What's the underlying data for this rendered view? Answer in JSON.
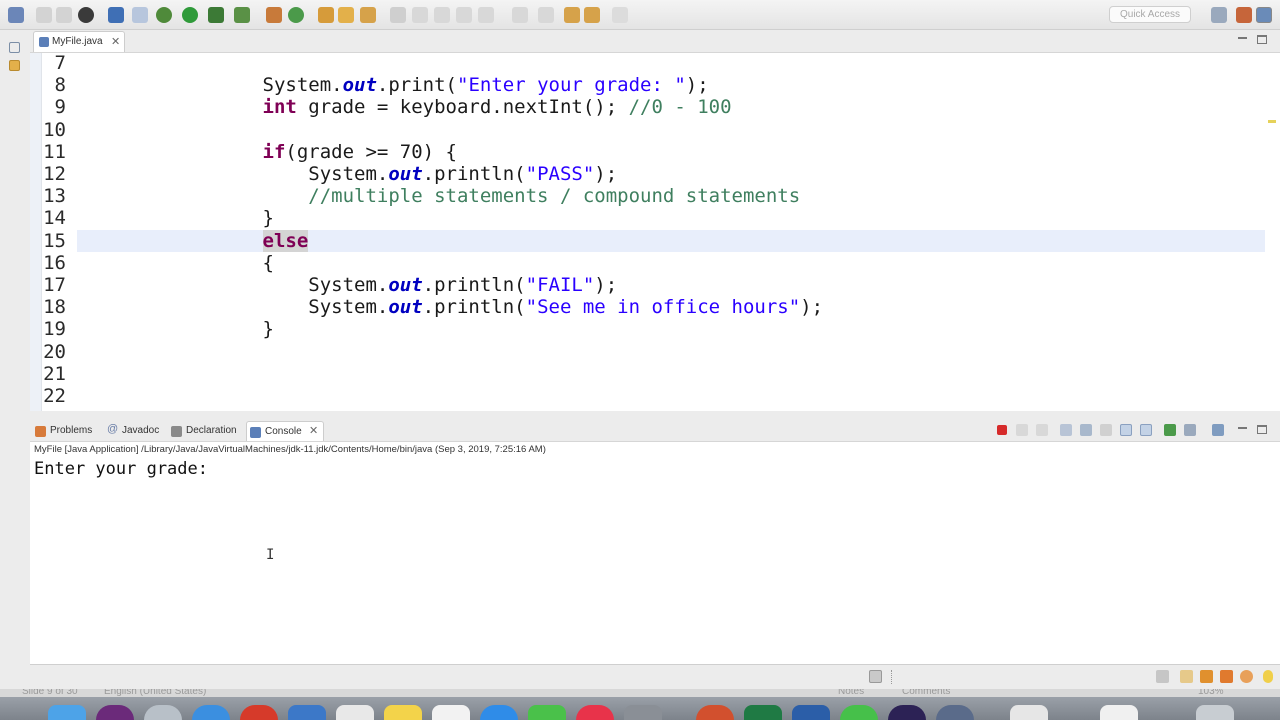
{
  "toolbar": {
    "quick_access_placeholder": "Quick Access"
  },
  "editor": {
    "tab_label": "MyFile.java",
    "lines": [
      {
        "num": "7",
        "tokens": []
      },
      {
        "num": "8",
        "tokens": [
          [
            "p",
            "        System."
          ],
          [
            "fld",
            "out"
          ],
          [
            "p",
            ".print("
          ],
          [
            "str",
            "\"Enter your grade: \""
          ],
          [
            "p",
            ");"
          ]
        ]
      },
      {
        "num": "9",
        "tokens": [
          [
            "p",
            "        "
          ],
          [
            "kw",
            "int"
          ],
          [
            "p",
            " grade = keyboard.nextInt(); "
          ],
          [
            "cmt",
            "//0 - 100"
          ]
        ]
      },
      {
        "num": "10",
        "tokens": []
      },
      {
        "num": "11",
        "tokens": [
          [
            "p",
            "        "
          ],
          [
            "kw",
            "if"
          ],
          [
            "p",
            "(grade >= 70) {"
          ]
        ]
      },
      {
        "num": "12",
        "tokens": [
          [
            "p",
            "            System."
          ],
          [
            "fld",
            "out"
          ],
          [
            "p",
            ".println("
          ],
          [
            "str",
            "\"PASS\""
          ],
          [
            "p",
            ");"
          ]
        ]
      },
      {
        "num": "13",
        "tokens": [
          [
            "p",
            "            "
          ],
          [
            "cmt",
            "//multiple statements / compound statements"
          ]
        ]
      },
      {
        "num": "14",
        "tokens": [
          [
            "p",
            "        }"
          ]
        ]
      },
      {
        "num": "15",
        "highlight": true,
        "tokens": [
          [
            "p",
            "        "
          ],
          [
            "kwsel",
            "else"
          ]
        ]
      },
      {
        "num": "16",
        "tokens": [
          [
            "p",
            "        {"
          ]
        ]
      },
      {
        "num": "17",
        "tokens": [
          [
            "p",
            "            System."
          ],
          [
            "fld",
            "out"
          ],
          [
            "p",
            ".println("
          ],
          [
            "str",
            "\"FAIL\""
          ],
          [
            "p",
            ");"
          ]
        ]
      },
      {
        "num": "18",
        "tokens": [
          [
            "p",
            "            System."
          ],
          [
            "fld",
            "out"
          ],
          [
            "p",
            ".println("
          ],
          [
            "str",
            "\"See me in office hours\""
          ],
          [
            "p",
            ");"
          ]
        ]
      },
      {
        "num": "19",
        "tokens": [
          [
            "p",
            "        }"
          ]
        ]
      },
      {
        "num": "20",
        "tokens": []
      },
      {
        "num": "21",
        "tokens": []
      },
      {
        "num": "22",
        "tokens": []
      }
    ]
  },
  "console": {
    "tabs": [
      "Problems",
      "Javadoc",
      "Declaration",
      "Console"
    ],
    "active_tab": "Console",
    "process_info": "MyFile [Java Application] /Library/Java/JavaVirtualMachines/jdk-11.jdk/Contents/Home/bin/java (Sep 3, 2019, 7:25:16 AM)",
    "output": "Enter your grade:"
  },
  "background": {
    "slide_info": "Slide 9 of 30",
    "language": "English (United States)",
    "notes": "Notes",
    "comments": "Comments",
    "zoom": "103%"
  },
  "colors": {
    "keyword": "#7f0055",
    "field": "#0000c0",
    "string": "#2a00ff",
    "comment": "#3f7f5f",
    "current_line": "#e8eefb"
  }
}
